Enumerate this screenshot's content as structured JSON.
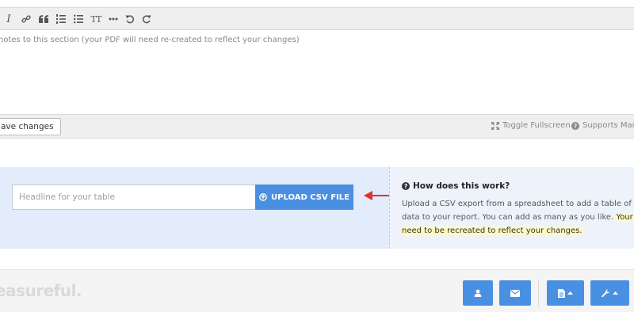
{
  "toolbar": {
    "icons": [
      "italic-icon",
      "link-icon",
      "quote-icon",
      "ordered-list-icon",
      "unordered-list-icon",
      "heading-icon",
      "horizontal-rule-icon",
      "undo-icon",
      "redo-icon"
    ],
    "heading_glyph": "TT"
  },
  "editor": {
    "placeholder": "notes to this section (your PDF will need re-created to reflect your changes)"
  },
  "editor_footer": {
    "save_label": "ave changes",
    "toggle_fullscreen": "Toggle Fullscreen",
    "supports_markdown": "Supports Markd"
  },
  "upload": {
    "headline_placeholder": "Headline for your table",
    "button_label": "UPLOAD CSV FILE",
    "button_color": "#4a90e2",
    "arrow_color": "#e03131"
  },
  "info": {
    "title": "How does this work?",
    "text_plain": "Upload a CSV export from a spreadsheet to add a table of custo data to your report. You can add as many as you like. ",
    "text_highlight": "Your PDF w need to be recreated to reflect your changes."
  },
  "bottom_bar": {
    "brand": "easureful.",
    "buttons": [
      "user-icon",
      "envelope-icon",
      "document-menu-icon",
      "wrench-menu-icon"
    ]
  }
}
